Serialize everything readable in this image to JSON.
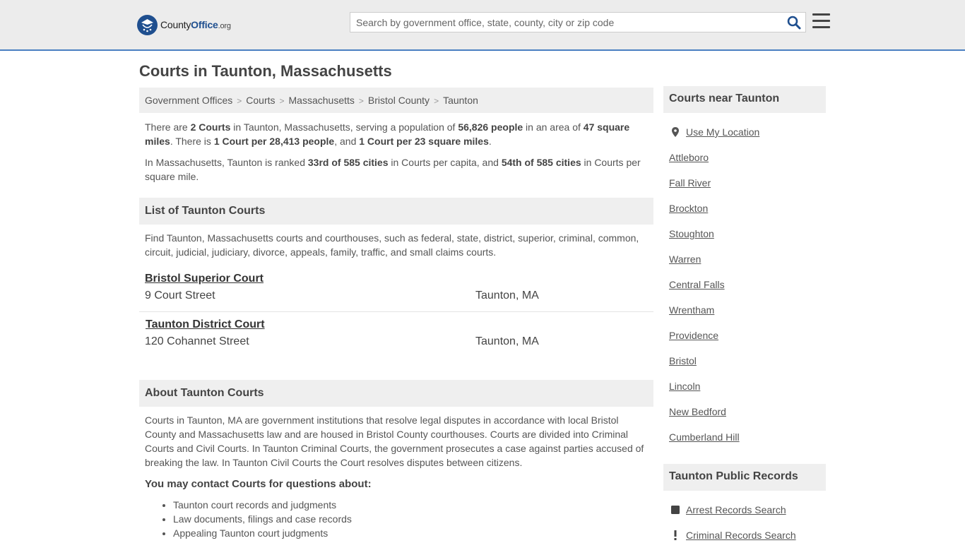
{
  "header": {
    "logo": {
      "county": "County",
      "office": "Office",
      "tld": ".org"
    },
    "search_placeholder": "Search by government office, state, county, city or zip code",
    "search_icon": "magnifier-icon",
    "menu_icon": "hamburger-menu-icon"
  },
  "page_title": "Courts in Taunton, Massachusetts",
  "breadcrumb": [
    "Government Offices",
    "Courts",
    "Massachusetts",
    "Bristol County",
    "Taunton"
  ],
  "intro": {
    "p1": {
      "t1": "There are ",
      "b1": "2 Courts",
      "t2": " in Taunton, Massachusetts, serving a population of ",
      "b2": "56,826 people",
      "t3": " in an area of ",
      "b3": "47 square miles",
      "t4": ". There is ",
      "b4": "1 Court per 28,413 people",
      "t5": ", and ",
      "b5": "1 Court per 23 square miles",
      "t6": "."
    },
    "p2": {
      "t1": "In Massachusetts, Taunton is ranked ",
      "b1": "33rd of 585 cities",
      "t2": " in Courts per capita, and ",
      "b2": "54th of 585 cities",
      "t3": " in Courts per square mile."
    }
  },
  "list_section": {
    "title": "List of Taunton Courts",
    "description": "Find Taunton, Massachusetts courts and courthouses, such as federal, state, district, superior, criminal, common, circuit, judicial, judiciary, divorce, appeals, family, traffic, and small claims courts.",
    "courts": [
      {
        "name": "Bristol Superior Court",
        "address": "9 Court Street",
        "city": "Taunton, MA"
      },
      {
        "name": "Taunton District Court",
        "address": "120 Cohannet Street",
        "city": "Taunton, MA"
      }
    ]
  },
  "about_section": {
    "title": "About Taunton Courts",
    "body": "Courts in Taunton, MA are government institutions that resolve legal disputes in accordance with local Bristol County and Massachusetts law and are housed in Bristol County courthouses. Courts are divided into Criminal Courts and Civil Courts. In Taunton Criminal Courts, the government prosecutes a case against parties accused of breaking the law. In Taunton Civil Courts the Court resolves disputes between citizens.",
    "contact_heading": "You may contact Courts for questions about:",
    "topics": [
      "Taunton court records and judgments",
      "Law documents, filings and case records",
      "Appealing Taunton court judgments"
    ]
  },
  "sidebar": {
    "nearby_title": "Courts near Taunton",
    "use_location": "Use My Location",
    "location_icon": "map-pin-icon",
    "nearby": [
      "Attleboro",
      "Fall River",
      "Brockton",
      "Stoughton",
      "Warren",
      "Central Falls",
      "Wrentham",
      "Providence",
      "Bristol",
      "Lincoln",
      "New Bedford",
      "Cumberland Hill"
    ],
    "records_title": "Taunton Public Records",
    "records": [
      {
        "label": "Arrest Records Search",
        "icon": "square-icon"
      },
      {
        "label": "Criminal Records Search",
        "icon": "exclamation-icon"
      }
    ]
  },
  "colors": {
    "brand": "#1f4f8f",
    "accent_line": "#4a7fc1",
    "panel": "#efefef"
  }
}
